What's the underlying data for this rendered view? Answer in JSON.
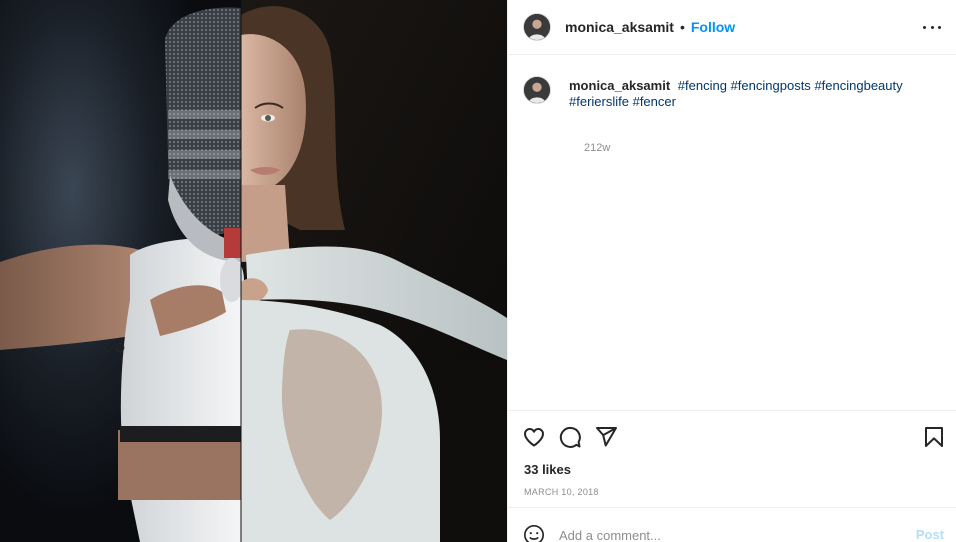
{
  "post": {
    "image_alt": "Fencer split image: masked fencer and portrait of a woman"
  },
  "header": {
    "username": "monica_aksamit",
    "separator": "•",
    "follow_label": "Follow",
    "more_icon": "more-options-icon"
  },
  "caption": {
    "username": "monica_aksamit",
    "hashtags": [
      "#fencing",
      "#fencingposts",
      "#fencingbeauty",
      "#ferierslife",
      "#fencer"
    ],
    "age": "212w"
  },
  "actions": {
    "icons": [
      "heart-icon",
      "comment-icon",
      "share-icon",
      "bookmark-icon"
    ],
    "likes": "33 likes",
    "date": "MARCH 10, 2018"
  },
  "comment_box": {
    "emoji_icon": "emoji-icon",
    "placeholder": "Add a comment...",
    "post_label": "Post"
  },
  "colors": {
    "accent": "#0095f6",
    "hashtag": "#00376b",
    "muted": "#8e8e8e",
    "post_disabled": "#b2dffc",
    "divider": "#efefef"
  }
}
